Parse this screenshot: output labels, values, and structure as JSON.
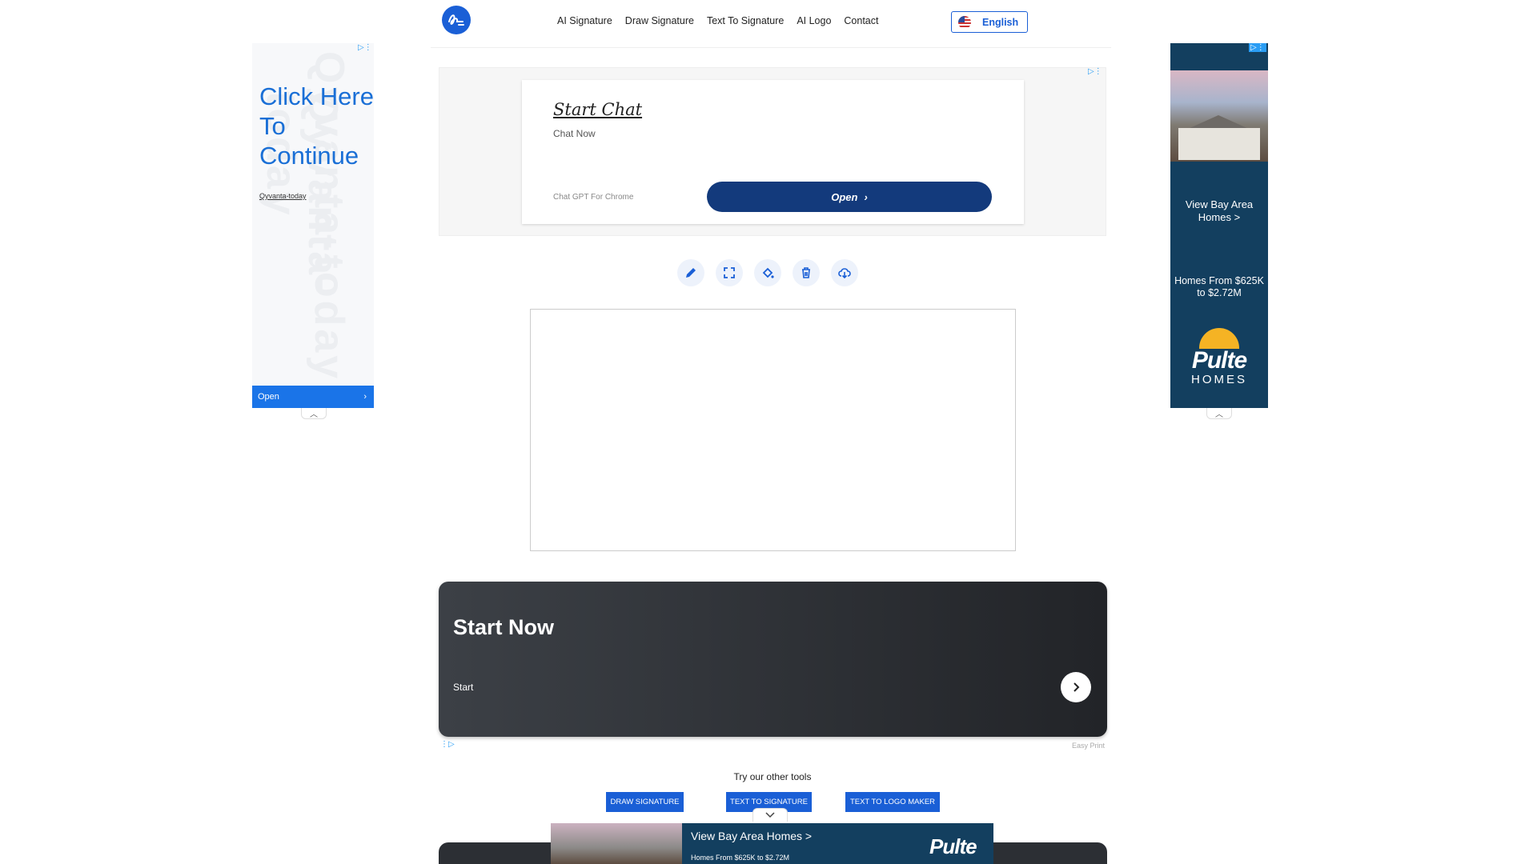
{
  "header": {
    "nav": [
      "AI Signature",
      "Draw Signature",
      "Text To Signature",
      "AI Logo",
      "Contact"
    ],
    "language": "English",
    "brand_color": "#1a5fd6"
  },
  "ad_left": {
    "watermark": "Qyvanta-today",
    "headline": "Click Here To Continue",
    "brand": "Qyvanta-today",
    "cta": "Open"
  },
  "ad_right": {
    "headline": "View Bay Area Homes >",
    "subline": "Homes From $625K to $2.72M",
    "logo_top": "Pulte",
    "logo_bottom": "HOMES"
  },
  "ad_top": {
    "title": "Start Chat",
    "subtitle": "Chat Now",
    "source": "Chat GPT For Chrome",
    "cta": "Open"
  },
  "toolbar": {
    "tools": [
      "pencil-icon",
      "fullscreen-icon",
      "paint-bucket-icon",
      "trash-icon",
      "cloud-download-icon"
    ]
  },
  "ad_start": {
    "title": "Start Now",
    "subtitle": "Start",
    "source": "Easy Print"
  },
  "other_tools": {
    "heading": "Try our other tools",
    "buttons": [
      "DRAW SIGNATURE",
      "TEXT TO SIGNATURE",
      "TEXT TO LOGO MAKER"
    ]
  },
  "ad_bottom": {
    "headline": "View Bay Area Homes >",
    "subline": "Homes From $625K to $2.72M",
    "logo_top": "Pulte"
  }
}
